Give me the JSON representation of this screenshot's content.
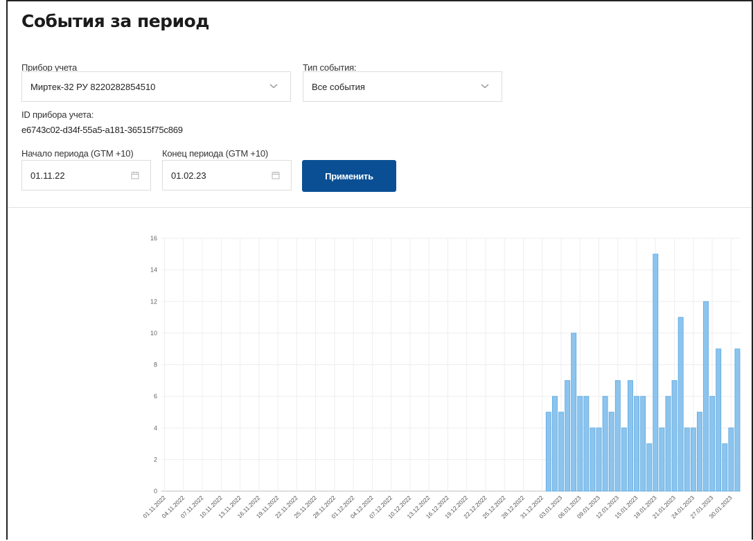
{
  "page": {
    "title": "События за период"
  },
  "filters": {
    "device_label": "Прибор учета",
    "device_value": "Миртек-32 РУ 8220282854510",
    "event_type_label": "Тип события:",
    "event_type_value": "Все события",
    "device_id_label": "ID прибора учета:",
    "device_id_value": "e6743c02-d34f-55a5-a181-36515f75c869",
    "start_label": "Начало периода (GTM +10)",
    "start_value": "01.11.22",
    "end_label": "Конец периода (GTM +10)",
    "end_value": "01.02.23",
    "apply_label": "Применить"
  },
  "icons": {
    "select_chevron": "chevron-down-icon",
    "date_picker": "calendar-icon"
  },
  "colors": {
    "accent": "#0a4f94",
    "bar_fill": "#8cc4ee",
    "bar_stroke": "#5aa8e0"
  },
  "chart_data": {
    "type": "bar",
    "title": "",
    "xlabel": "",
    "ylabel": "",
    "ylim": [
      0,
      16
    ],
    "yticks": [
      0,
      2,
      4,
      6,
      8,
      10,
      12,
      14,
      16
    ],
    "grid": true,
    "x_tick_labels": [
      "01.11.2022",
      "04.11.2022",
      "07.11.2022",
      "10.11.2022",
      "13.11.2022",
      "16.11.2022",
      "19.11.2022",
      "22.11.2022",
      "25.11.2022",
      "28.11.2022",
      "01.12.2022",
      "04.12.2022",
      "07.12.2022",
      "10.12.2022",
      "13.12.2022",
      "16.12.2022",
      "19.12.2022",
      "22.12.2022",
      "25.12.2022",
      "28.12.2022",
      "31.12.2022",
      "03.01.2023",
      "06.01.2023",
      "09.01.2023",
      "12.01.2023",
      "15.01.2023",
      "18.01.2023",
      "21.01.2023",
      "24.01.2023",
      "27.01.2023",
      "30.01.2023"
    ],
    "categories": [
      "01.11.2022",
      "02.11.2022",
      "03.11.2022",
      "04.11.2022",
      "05.11.2022",
      "06.11.2022",
      "07.11.2022",
      "08.11.2022",
      "09.11.2022",
      "10.11.2022",
      "11.11.2022",
      "12.11.2022",
      "13.11.2022",
      "14.11.2022",
      "15.11.2022",
      "16.11.2022",
      "17.11.2022",
      "18.11.2022",
      "19.11.2022",
      "20.11.2022",
      "21.11.2022",
      "22.11.2022",
      "23.11.2022",
      "24.11.2022",
      "25.11.2022",
      "26.11.2022",
      "27.11.2022",
      "28.11.2022",
      "29.11.2022",
      "30.11.2022",
      "01.12.2022",
      "02.12.2022",
      "03.12.2022",
      "04.12.2022",
      "05.12.2022",
      "06.12.2022",
      "07.12.2022",
      "08.12.2022",
      "09.12.2022",
      "10.12.2022",
      "11.12.2022",
      "12.12.2022",
      "13.12.2022",
      "14.12.2022",
      "15.12.2022",
      "16.12.2022",
      "17.12.2022",
      "18.12.2022",
      "19.12.2022",
      "20.12.2022",
      "21.12.2022",
      "22.12.2022",
      "23.12.2022",
      "24.12.2022",
      "25.12.2022",
      "26.12.2022",
      "27.12.2022",
      "28.12.2022",
      "29.12.2022",
      "30.12.2022",
      "31.12.2022",
      "01.01.2023",
      "02.01.2023",
      "03.01.2023",
      "04.01.2023",
      "05.01.2023",
      "06.01.2023",
      "07.01.2023",
      "08.01.2023",
      "09.01.2023",
      "10.01.2023",
      "11.01.2023",
      "12.01.2023",
      "13.01.2023",
      "14.01.2023",
      "15.01.2023",
      "16.01.2023",
      "17.01.2023",
      "18.01.2023",
      "19.01.2023",
      "20.01.2023",
      "21.01.2023",
      "22.01.2023",
      "23.01.2023",
      "24.01.2023",
      "25.01.2023",
      "26.01.2023",
      "27.01.2023",
      "28.01.2023",
      "29.01.2023",
      "30.01.2023",
      "31.01.2023"
    ],
    "values": [
      0,
      0,
      0,
      0,
      0,
      0,
      0,
      0,
      0,
      0,
      0,
      0,
      0,
      0,
      0,
      0,
      0,
      0,
      0,
      0,
      0,
      0,
      0,
      0,
      0,
      0,
      0,
      0,
      0,
      0,
      0,
      0,
      0,
      0,
      0,
      0,
      0,
      0,
      0,
      0,
      0,
      0,
      0,
      0,
      0,
      0,
      0,
      0,
      0,
      0,
      0,
      0,
      0,
      0,
      0,
      0,
      0,
      0,
      0,
      0,
      0,
      5,
      6,
      5,
      7,
      10,
      6,
      6,
      4,
      4,
      6,
      5,
      7,
      4,
      7,
      6,
      6,
      3,
      15,
      4,
      6,
      7,
      11,
      4,
      4,
      5,
      12,
      6,
      9,
      3,
      4,
      9
    ]
  }
}
